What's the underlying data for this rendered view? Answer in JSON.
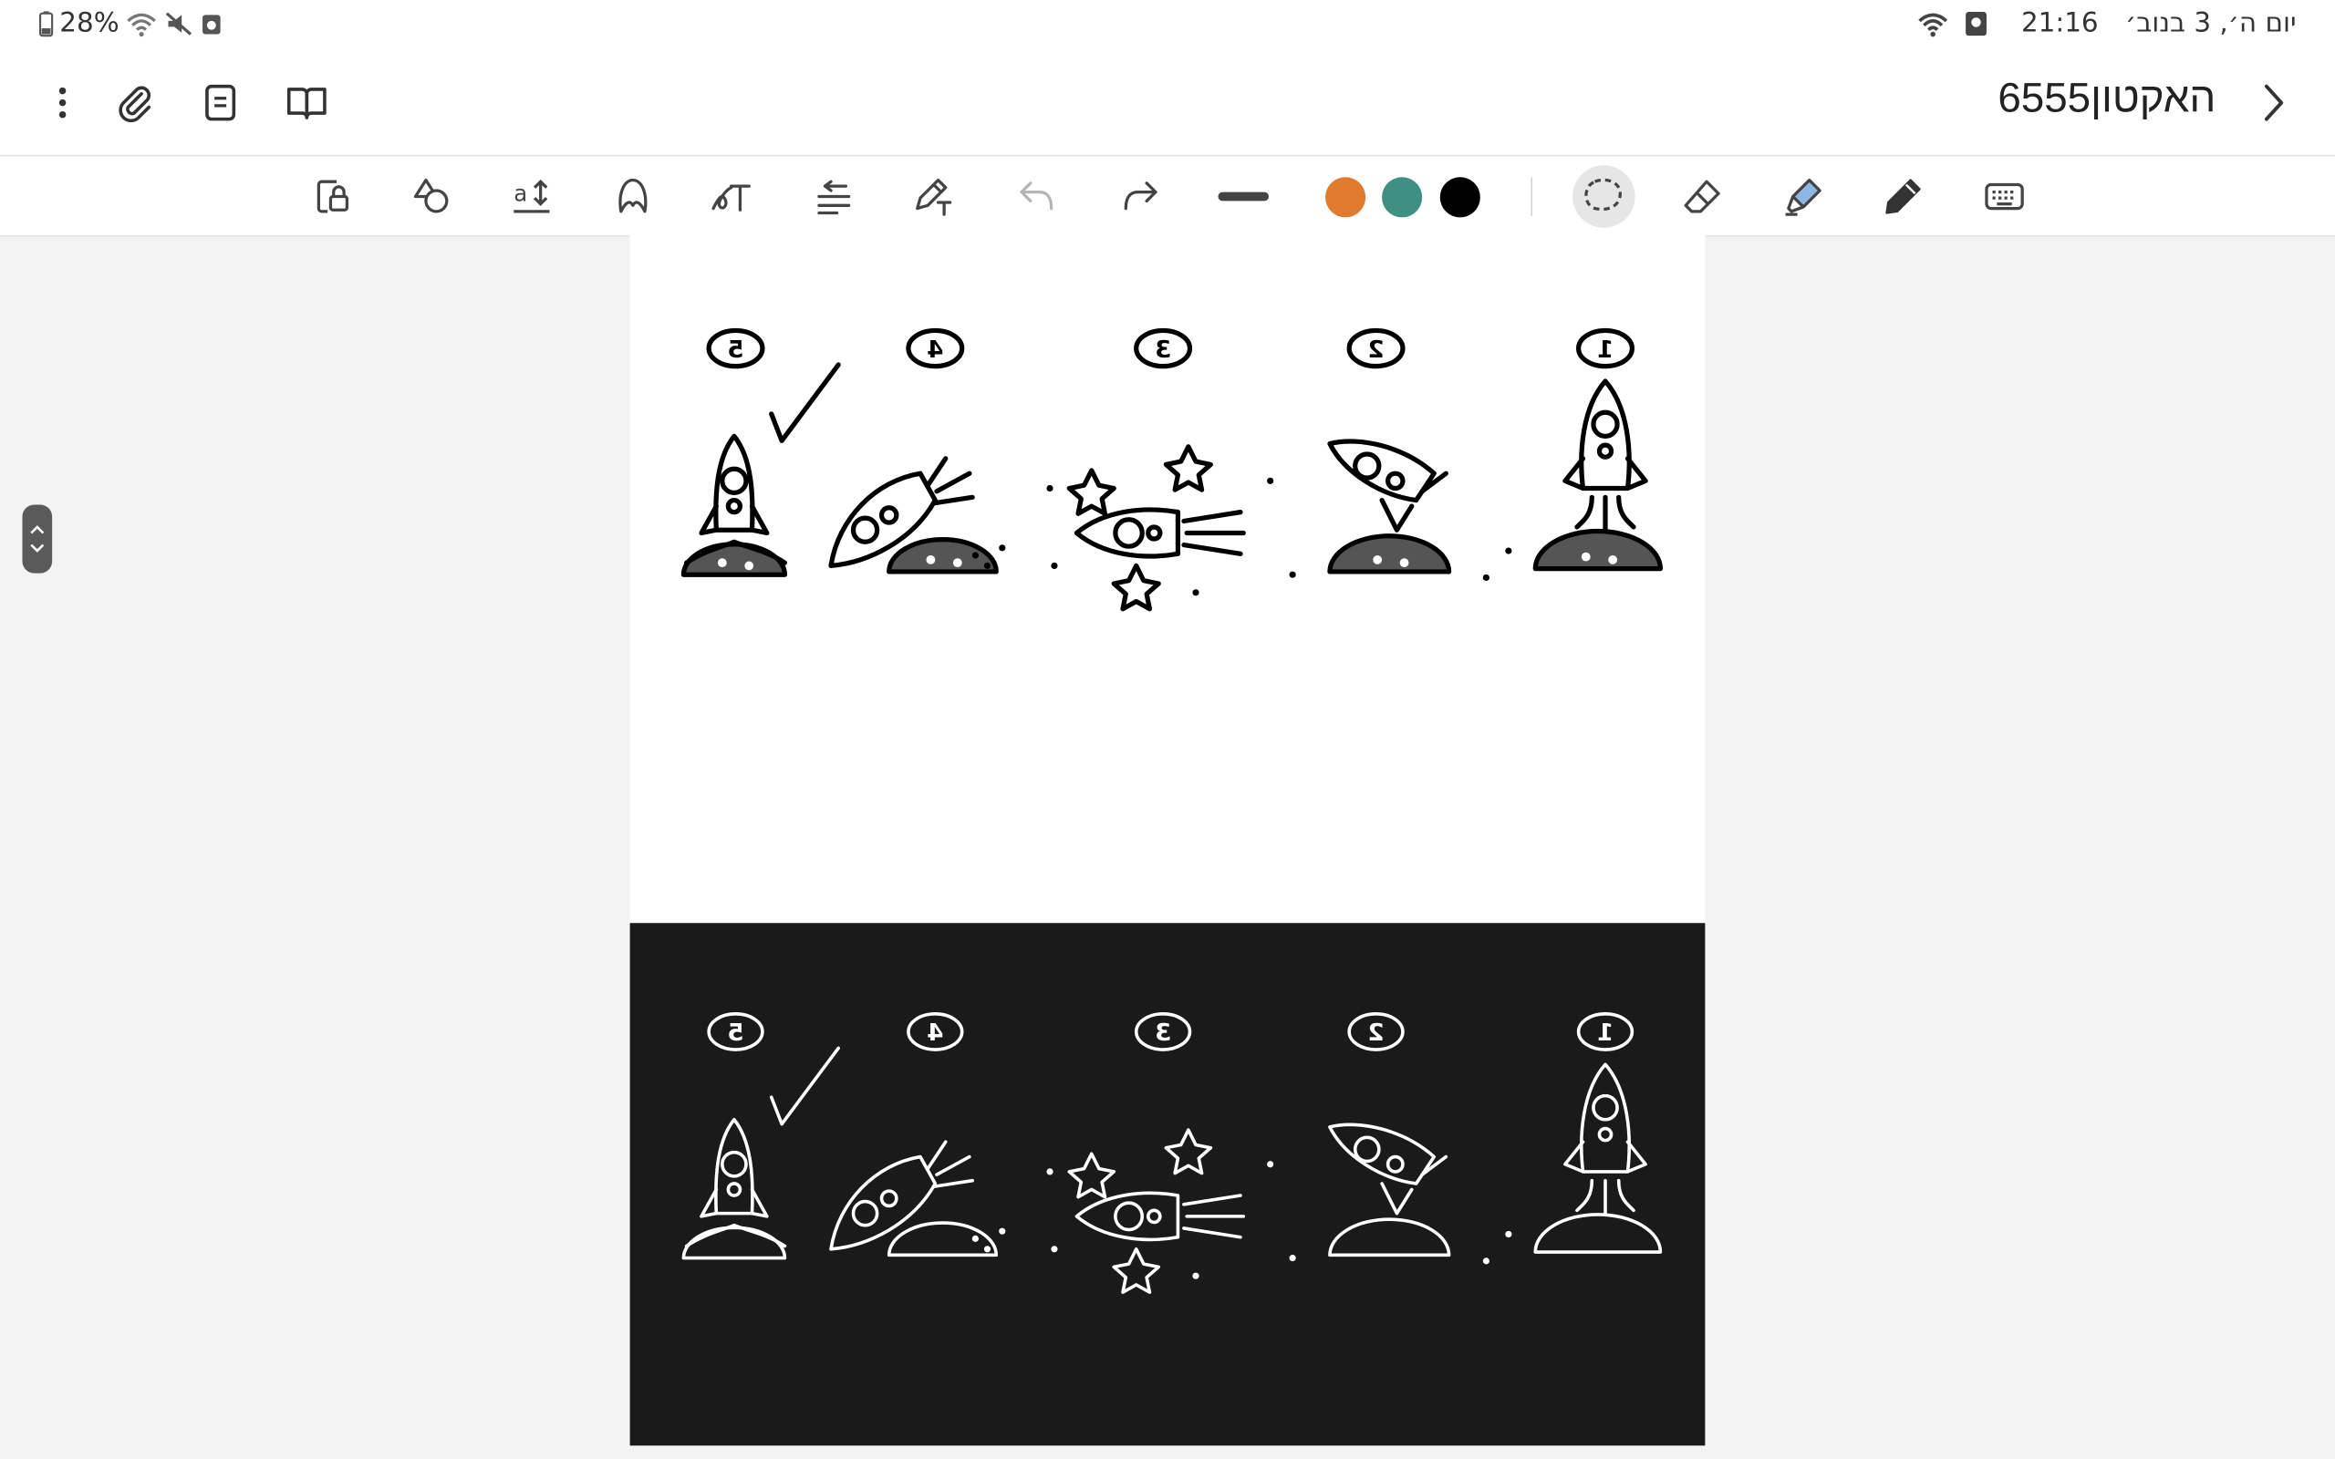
{
  "status_bar": {
    "battery": "28%",
    "time": "21:16",
    "date": "יום ה׳, 3 בנוב׳"
  },
  "header": {
    "title": "האקטון6555",
    "icons": [
      "more-icon",
      "attachment-icon",
      "page-icon",
      "book-icon",
      "chevron-right-icon"
    ]
  },
  "toolbar": {
    "tools": [
      "lock-page-icon",
      "shapes-icon",
      "text-size-icon",
      "pen-shape-icon",
      "handwriting-text-icon",
      "convert-icon",
      "pen-text-icon",
      "undo-icon",
      "redo-icon",
      "stroke-width-icon",
      "lasso-icon",
      "eraser-icon",
      "highlighter-icon",
      "pen-icon",
      "keyboard-icon"
    ],
    "colors": [
      "#e07a2f",
      "#3f8f82",
      "#000000"
    ]
  },
  "canvas": {
    "rows": [
      {
        "theme": "light",
        "steps": [
          "5",
          "4",
          "3",
          "2",
          "1"
        ]
      },
      {
        "theme": "dark",
        "steps": [
          "5",
          "4",
          "3",
          "2",
          "1"
        ]
      }
    ]
  }
}
